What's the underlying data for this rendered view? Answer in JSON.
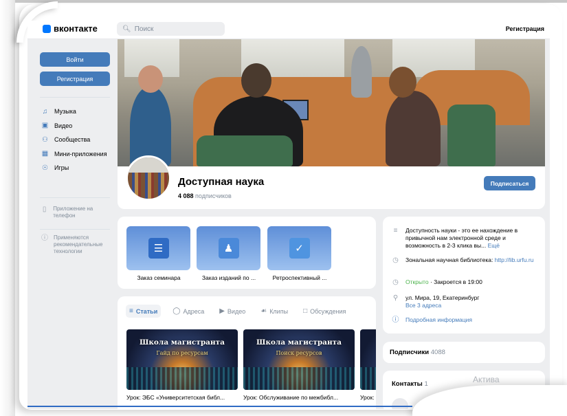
{
  "header": {
    "logo": "вконтакте",
    "search_placeholder": "Поиск",
    "register": "Регистрация"
  },
  "sidebar": {
    "login_button": "Войти",
    "register_button": "Регистрация",
    "items": [
      {
        "label": "Музыка",
        "icon": "music-icon"
      },
      {
        "label": "Видео",
        "icon": "video-icon"
      },
      {
        "label": "Сообщества",
        "icon": "communities-icon"
      },
      {
        "label": "Мини-приложения",
        "icon": "mini-apps-icon"
      },
      {
        "label": "Игры",
        "icon": "games-icon"
      }
    ],
    "app_note": "Приложение на телефон",
    "rec_note": "Применяются рекомендательные технологии"
  },
  "profile": {
    "name": "Доступная наука",
    "subscribers_count": "4 088",
    "subscribers_word": "подписчиков",
    "subscribe_button": "Подписаться"
  },
  "apps": [
    {
      "label": "Заказ семинара",
      "icon": "checklist-icon"
    },
    {
      "label": "Заказ изданий по ...",
      "icon": "users-icon"
    },
    {
      "label": "Ретроспективный ...",
      "icon": "check-icon"
    }
  ],
  "tabs": [
    {
      "label": "Статьи",
      "icon": "articles-icon",
      "active": true
    },
    {
      "label": "Адреса",
      "icon": "pin-icon",
      "active": false
    },
    {
      "label": "Видео",
      "icon": "video-icon",
      "active": false
    },
    {
      "label": "Клипы",
      "icon": "clips-icon",
      "active": false
    },
    {
      "label": "Обсуждения",
      "icon": "discussion-icon",
      "active": false
    }
  ],
  "posts": [
    {
      "line1": "Школа магистранта",
      "line2": "Гайд по ресурсам",
      "title": "Урок: ЭБС «Университетская библ..."
    },
    {
      "line1": "Школа магистранта",
      "line2": "Поиск ресурсов",
      "title": "Урок: Обслуживание по межбибл..."
    },
    {
      "line1": "",
      "line2": "",
      "title": "Урок:"
    }
  ],
  "info": {
    "description": "Доступность науки - это ее нахождение в привычной нам электронной среде и возможность в 2-3 клика вы...",
    "more": "Ещё",
    "website_label": "Зональная научная библиотека:",
    "website_url": "http://lib.urfu.ru",
    "open_status": "Открыто",
    "closes": "· Закроется в 19:00",
    "address": "ул. Мира, 19, Екатеринбург",
    "all_addresses": "Все 3 адреса",
    "details": "Подробная информация"
  },
  "subscribers_card": {
    "label": "Подписчики",
    "count": "4088"
  },
  "contacts_card": {
    "label": "Контакты",
    "count": "1"
  },
  "overlay_text": "Актива",
  "colors": {
    "accent": "#447bba",
    "open": "#4bb34b",
    "background": "#edeef0"
  }
}
